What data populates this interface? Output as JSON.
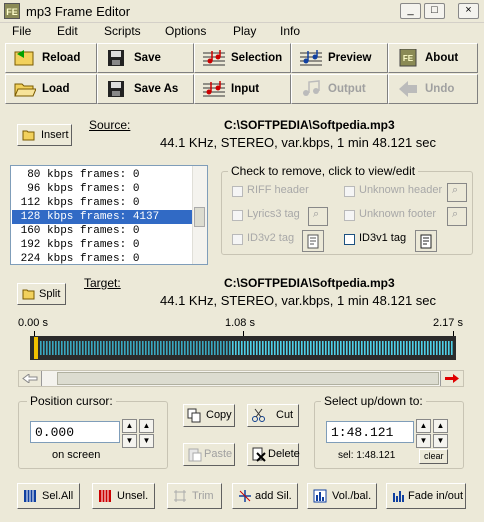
{
  "window": {
    "icon_text": "FE",
    "title": "mp3 Frame Editor"
  },
  "menu": [
    "File",
    "Edit",
    "Scripts",
    "Options",
    "Play",
    "Info"
  ],
  "toolbar": {
    "reload": "Reload",
    "save": "Save",
    "selection": "Selection",
    "preview": "Preview",
    "about": "About",
    "load": "Load",
    "save_as": "Save As",
    "input": "Input",
    "output": "Output",
    "undo": "Undo"
  },
  "source": {
    "insert_label": "Insert",
    "label": "Source:",
    "path": "C:\\SOFTPEDIA\\Softpedia.mp3",
    "info": "44.1 KHz, STEREO, var.kbps, 1 min 48.121 sec"
  },
  "frames_list": [
    "  80 kbps frames: 0",
    "  96 kbps frames: 0",
    " 112 kbps frames: 0",
    " 128 kbps frames: 4137",
    " 160 kbps frames: 0",
    " 192 kbps frames: 0",
    " 224 kbps frames: 0"
  ],
  "selected_frame_index": 3,
  "check_group": {
    "title": "Check to remove, click to view/edit",
    "riff": "RIFF header",
    "unknown_header": "Unknown header",
    "lyrics3": "Lyrics3 tag",
    "unknown_footer": "Unknown footer",
    "id3v2": "ID3v2 tag",
    "id3v1": "ID3v1 tag"
  },
  "target": {
    "split_label": "Split",
    "label": "Target:",
    "path": "C:\\SOFTPEDIA\\Softpedia.mp3",
    "info": "44.1 KHz, STEREO, var.kbps, 1 min 48.121 sec"
  },
  "timeline": {
    "start": "0.00 s",
    "mid": "1.08 s",
    "end": "2.17 s"
  },
  "cursor_group": {
    "title": "Position cursor:",
    "value": "0.000",
    "sub": "on screen"
  },
  "edit_buttons": {
    "copy": "Copy",
    "cut": "Cut",
    "paste": "Paste",
    "delete": "Delete"
  },
  "select_group": {
    "title": "Select up/down to:",
    "value": "1:48.121",
    "sel_label": "sel: 1:48.121",
    "clear": "clear"
  },
  "bottom": {
    "sel_all": "Sel.All",
    "unsel": "Unsel.",
    "trim": "Trim",
    "add_sil": "add Sil.",
    "vol_bal": "Vol./bal.",
    "fade": "Fade in/out"
  }
}
